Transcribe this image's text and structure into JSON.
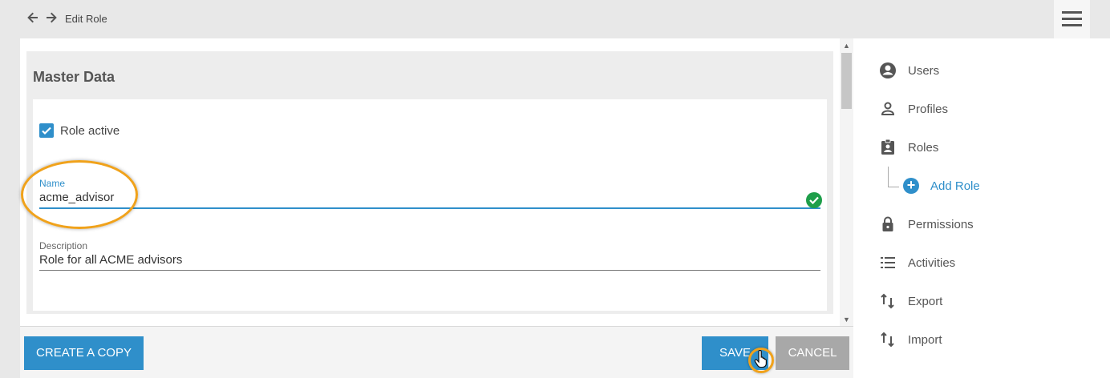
{
  "header": {
    "breadcrumb": "Edit Role",
    "back_icon": "arrow-left-icon",
    "forward_icon": "arrow-right-icon",
    "menu_icon": "hamburger-menu-icon"
  },
  "panel": {
    "title": "Master Data",
    "role_active": {
      "label": "Role active",
      "checked": true
    },
    "name": {
      "label": "Name",
      "value": "acme_advisor",
      "valid": true
    },
    "description": {
      "label": "Description",
      "value": "Role for all ACME advisors"
    }
  },
  "footer": {
    "copy_label": "CREATE A COPY",
    "save_label": "SAVE",
    "cancel_label": "CANCEL"
  },
  "sidebar": {
    "items": [
      {
        "label": "Users",
        "icon": "account-circle-icon"
      },
      {
        "label": "Profiles",
        "icon": "person-outline-icon"
      },
      {
        "label": "Roles",
        "icon": "clipboard-account-icon"
      },
      {
        "label": "Permissions",
        "icon": "lock-icon"
      },
      {
        "label": "Activities",
        "icon": "list-icon"
      },
      {
        "label": "Export",
        "icon": "swap-vertical-icon"
      },
      {
        "label": "Import",
        "icon": "swap-vertical-icon"
      }
    ],
    "sub_item": {
      "label": "Add Role",
      "icon": "add-circle-icon"
    }
  },
  "colors": {
    "accent": "#2f8fca",
    "highlight": "#f0a21b",
    "valid": "#1e9e4a",
    "cancel": "#a8a8a8"
  }
}
